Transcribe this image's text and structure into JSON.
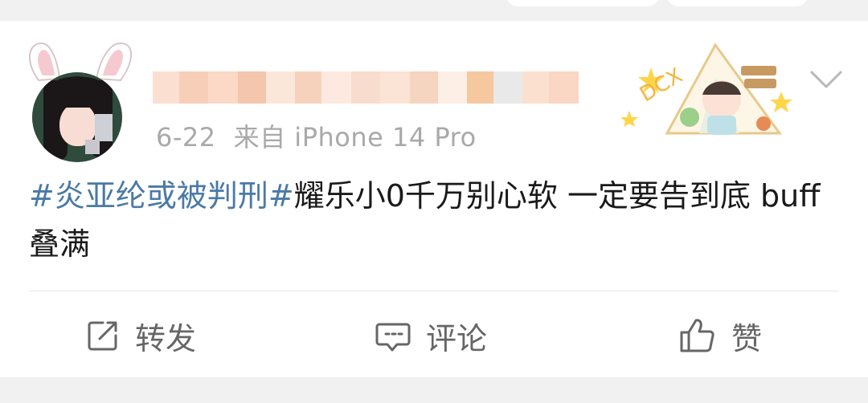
{
  "post": {
    "date": "6-22",
    "source": "来自 iPhone 14 Pro",
    "hashtag": "#炎亚纶或被判刑#",
    "body": "耀乐小0千万别心软 一定要告到底 buff叠满"
  },
  "actions": {
    "repost_label": "转发",
    "comment_label": "评论",
    "like_label": "赞"
  },
  "icons": {
    "repost": "edit-square-icon",
    "comment": "comment-bubble-icon",
    "like": "thumbs-up-icon",
    "more": "chevron-down-icon"
  },
  "colors": {
    "hashtag": "#4a7aa6",
    "text": "#1a1a1a",
    "meta": "#a9a9a9",
    "action": "#666666"
  }
}
